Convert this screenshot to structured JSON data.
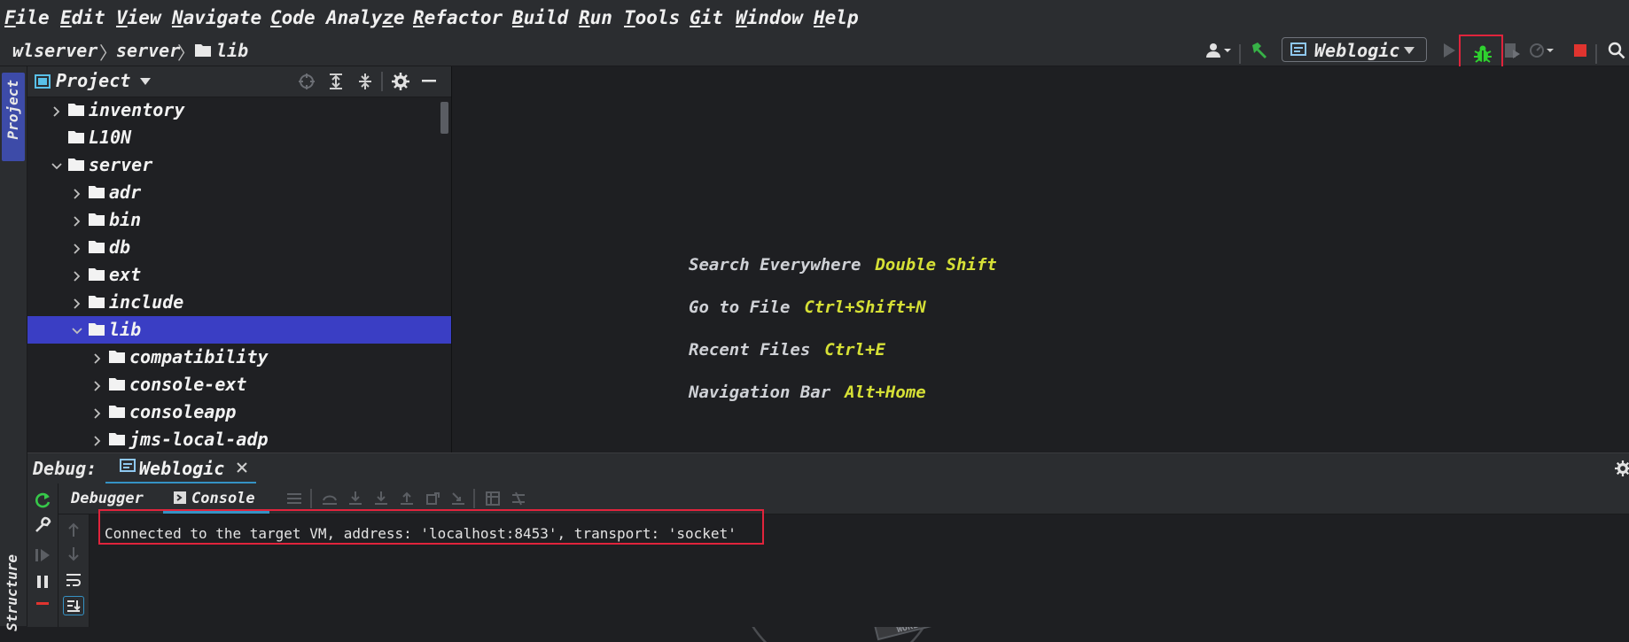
{
  "menu": {
    "items": [
      "File",
      "Edit",
      "View",
      "Navigate",
      "Code",
      "Analyze",
      "Refactor",
      "Build",
      "Run",
      "Tools",
      "Git",
      "Window",
      "Help"
    ],
    "mnemonics": [
      "F",
      "E",
      "V",
      "N",
      "C",
      "z",
      "R",
      "B",
      "R",
      "T",
      "G",
      "W",
      "H"
    ]
  },
  "breadcrumb": {
    "items": [
      "wlserver",
      "server",
      "lib"
    ]
  },
  "toolbar": {
    "run_config": "Weblogic"
  },
  "stripe": {
    "project": "Project",
    "structure": "Structure"
  },
  "project": {
    "title": "Project",
    "tree": [
      {
        "label": "inventory",
        "depth": 0,
        "expanded": false,
        "has_children": true
      },
      {
        "label": "L10N",
        "depth": 0,
        "expanded": false,
        "has_children": false
      },
      {
        "label": "server",
        "depth": 0,
        "expanded": true,
        "has_children": true
      },
      {
        "label": "adr",
        "depth": 1,
        "expanded": false,
        "has_children": true
      },
      {
        "label": "bin",
        "depth": 1,
        "expanded": false,
        "has_children": true
      },
      {
        "label": "db",
        "depth": 1,
        "expanded": false,
        "has_children": true
      },
      {
        "label": "ext",
        "depth": 1,
        "expanded": false,
        "has_children": true
      },
      {
        "label": "include",
        "depth": 1,
        "expanded": false,
        "has_children": true
      },
      {
        "label": "lib",
        "depth": 1,
        "expanded": true,
        "has_children": true,
        "selected": true
      },
      {
        "label": "compatibility",
        "depth": 2,
        "expanded": false,
        "has_children": true
      },
      {
        "label": "console-ext",
        "depth": 2,
        "expanded": false,
        "has_children": true
      },
      {
        "label": "consoleapp",
        "depth": 2,
        "expanded": false,
        "has_children": true
      },
      {
        "label": "jms-local-adp",
        "depth": 2,
        "expanded": false,
        "has_children": true
      }
    ]
  },
  "editor": {
    "hints": [
      {
        "action": "Search Everywhere",
        "keys": "Double Shift"
      },
      {
        "action": "Go to File",
        "keys": "Ctrl+Shift+N"
      },
      {
        "action": "Recent Files",
        "keys": "Ctrl+E"
      },
      {
        "action": "Navigation Bar",
        "keys": "Alt+Home"
      }
    ],
    "watermark_sign": "GOOD BYE, CRUEL WORLD"
  },
  "debug": {
    "label": "Debug:",
    "session_tab": "Weblogic",
    "subtabs": {
      "debugger": "Debugger",
      "console": "Console"
    },
    "console_output": "Connected to the target VM, address: 'localhost:8453', transport: 'socket'"
  },
  "colors": {
    "accent_selected": "#3a3ec4",
    "hint_keys": "#d6e036",
    "highlight_box": "#e0243c",
    "debug_bug_icon": "#2fd12f",
    "stop_icon": "#e0342f",
    "build_hammer": "#37b247"
  }
}
